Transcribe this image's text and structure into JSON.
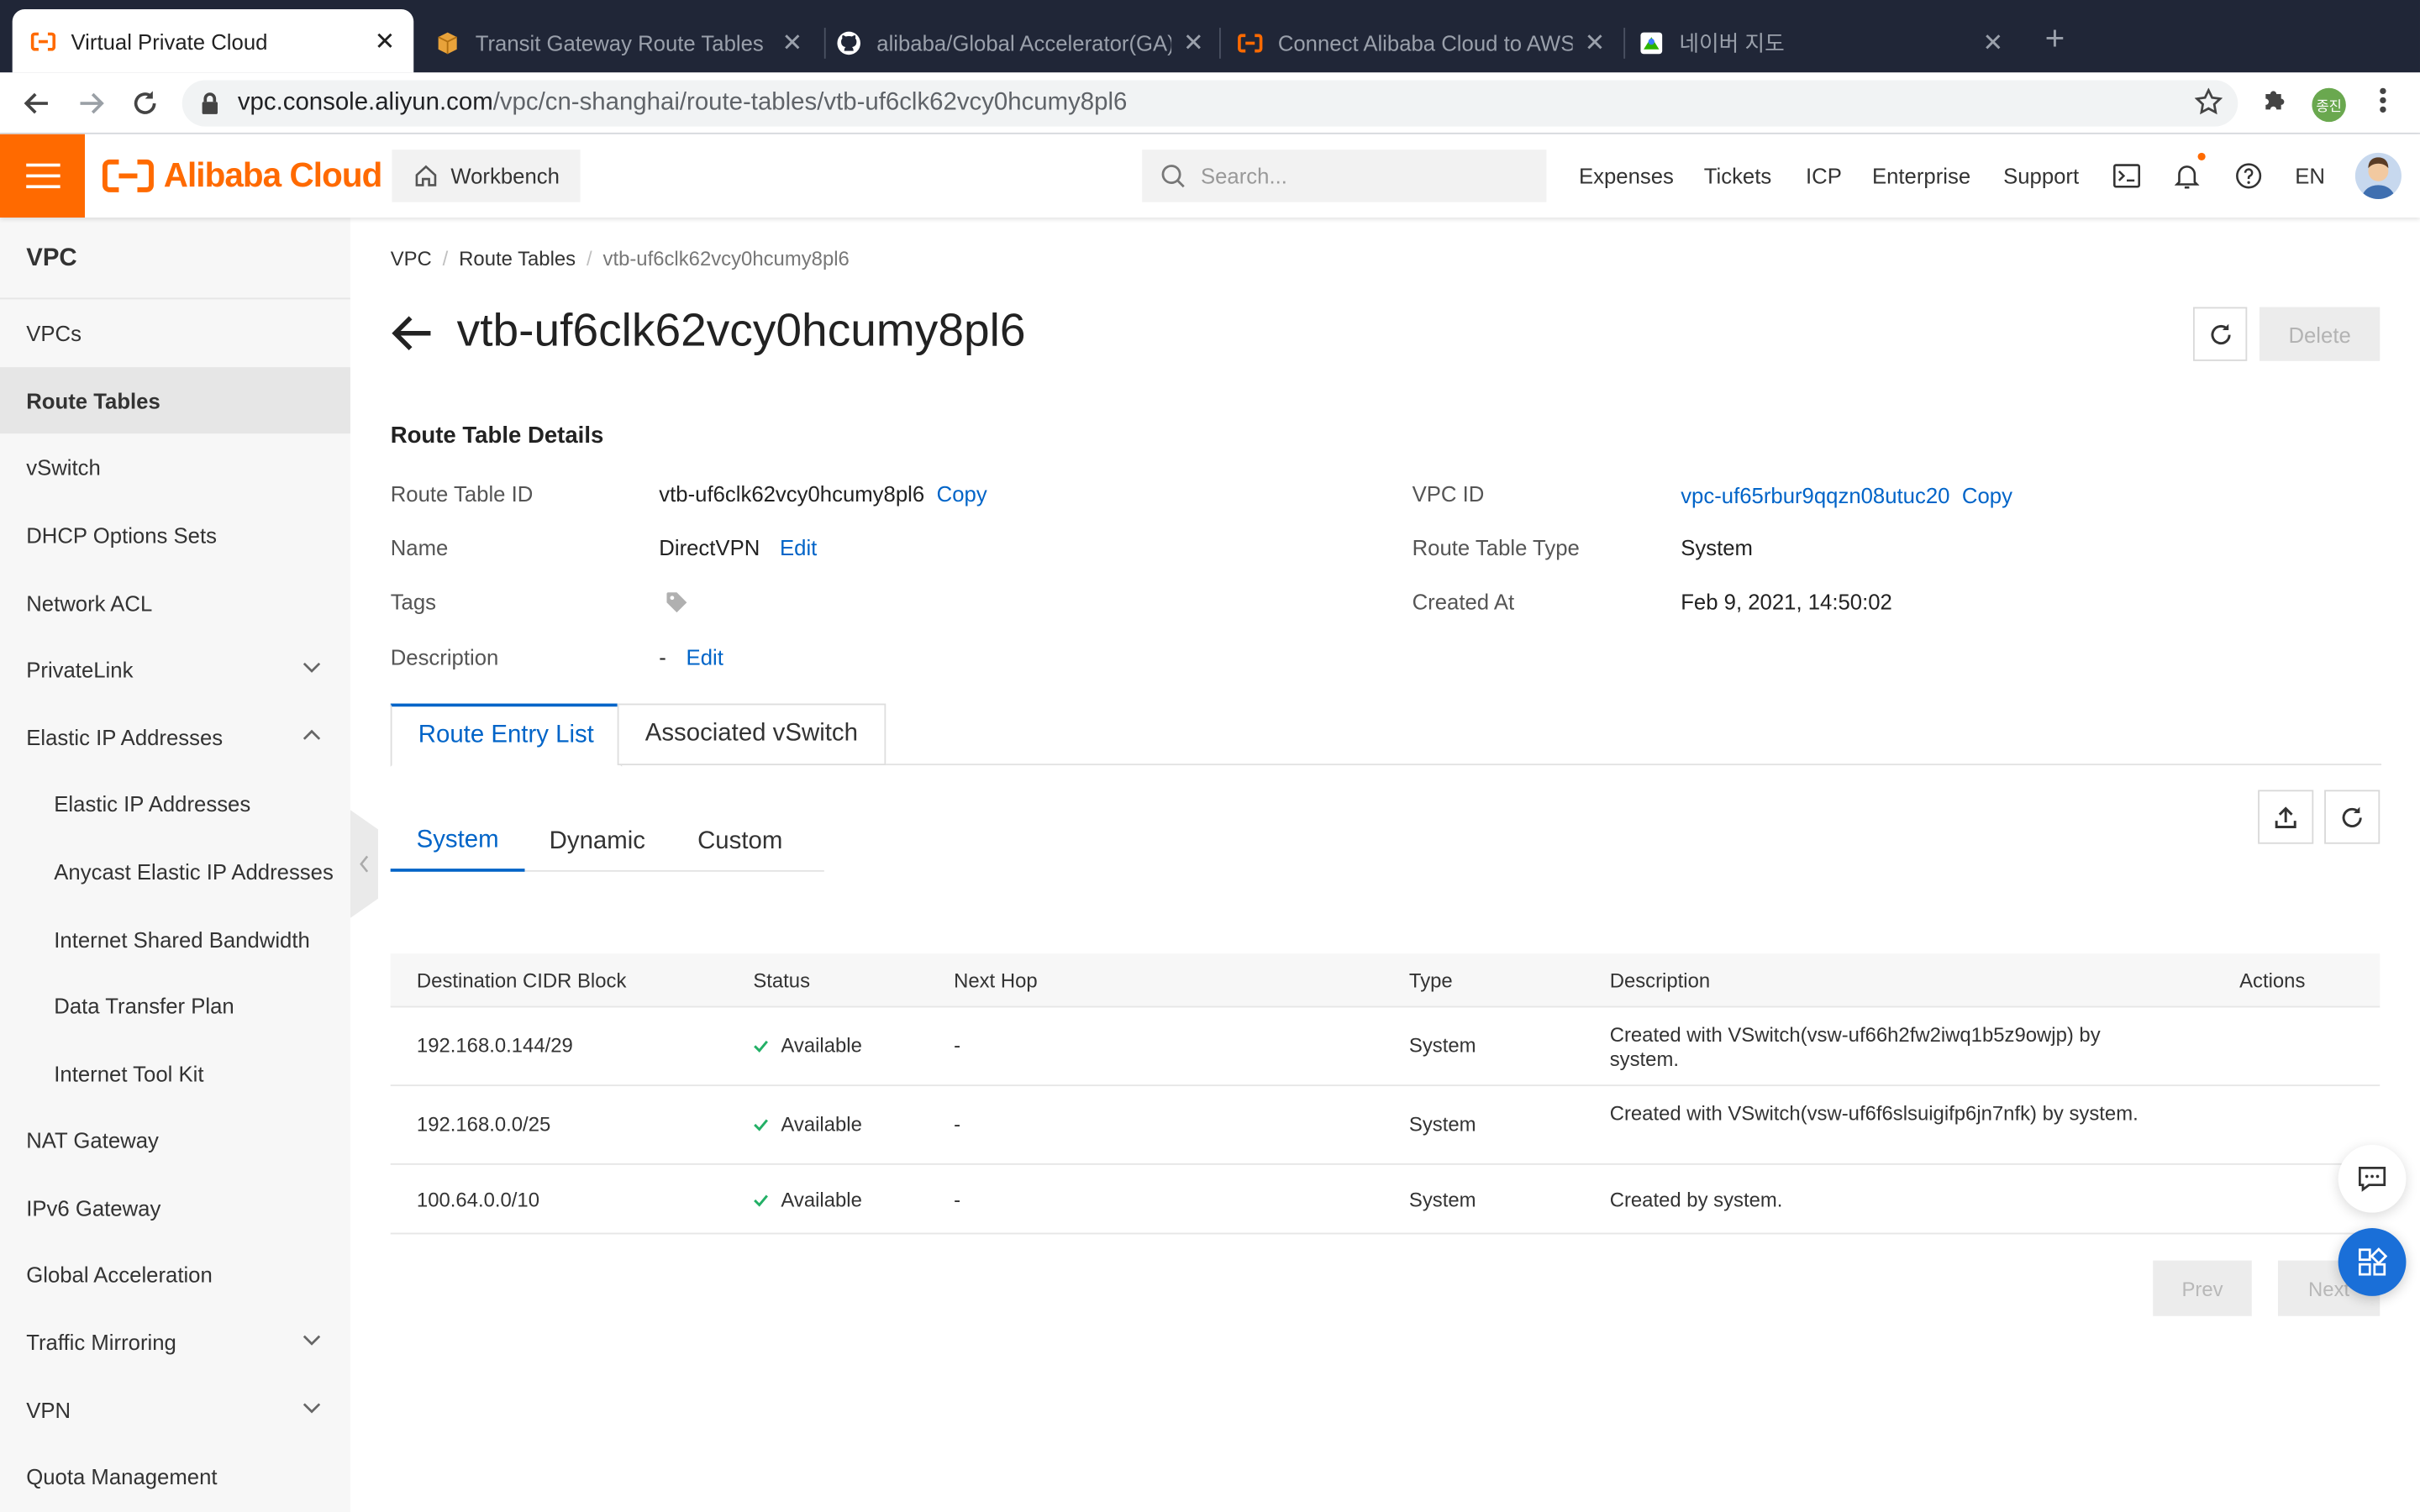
{
  "browser": {
    "tabs": [
      {
        "label": "Virtual Private Cloud"
      },
      {
        "label": "Transit Gateway Route Tables |"
      },
      {
        "label": "alibaba/Global Accelerator(GA)"
      },
      {
        "label": "Connect Alibaba Cloud to AWS"
      },
      {
        "label": "네이버 지도"
      }
    ],
    "url_host": "vpc.console.aliyun.com",
    "url_path": "/vpc/cn-shanghai/route-tables/vtb-uf6clk62vcy0hcumy8pl6",
    "profile_label": "종진"
  },
  "header": {
    "brand": "Alibaba Cloud",
    "workbench": "Workbench",
    "search_placeholder": "Search...",
    "links": [
      "Expenses",
      "Tickets",
      "ICP",
      "Enterprise",
      "Support"
    ],
    "lang": "EN"
  },
  "sidebar": {
    "title": "VPC",
    "items": [
      {
        "label": "VPCs"
      },
      {
        "label": "Route Tables"
      },
      {
        "label": "vSwitch"
      },
      {
        "label": "DHCP Options Sets"
      },
      {
        "label": "Network ACL"
      },
      {
        "label": "PrivateLink"
      },
      {
        "label": "Elastic IP Addresses"
      },
      {
        "label": "Elastic IP Addresses"
      },
      {
        "label": "Anycast Elastic IP Addresses"
      },
      {
        "label": "Internet Shared Bandwidth"
      },
      {
        "label": "Data Transfer Plan"
      },
      {
        "label": "Internet Tool Kit"
      },
      {
        "label": "NAT Gateway"
      },
      {
        "label": "IPv6 Gateway"
      },
      {
        "label": "Global Acceleration"
      },
      {
        "label": "Traffic Mirroring"
      },
      {
        "label": "VPN"
      },
      {
        "label": "Quota Management"
      }
    ]
  },
  "breadcrumb": [
    "VPC",
    "Route Tables",
    "vtb-uf6clk62vcy0hcumy8pl6"
  ],
  "page": {
    "title": "vtb-uf6clk62vcy0hcumy8pl6",
    "delete_label": "Delete"
  },
  "details": {
    "section_title": "Route Table Details",
    "route_table_id_label": "Route Table ID",
    "route_table_id": "vtb-uf6clk62vcy0hcumy8pl6",
    "copy_label": "Copy",
    "name_label": "Name",
    "name": "DirectVPN",
    "edit_label": "Edit",
    "tags_label": "Tags",
    "description_label": "Description",
    "description": "-",
    "vpc_id_label": "VPC ID",
    "vpc_id": "vpc-uf65rbur9qqzn08utuc20",
    "type_label": "Route Table Type",
    "type": "System",
    "created_label": "Created At",
    "created": "Feb 9, 2021, 14:50:02"
  },
  "tabs_main": [
    "Route Entry List",
    "Associated vSwitch"
  ],
  "tabs_sub": [
    "System",
    "Dynamic",
    "Custom"
  ],
  "table": {
    "columns": [
      "Destination CIDR Block",
      "Status",
      "Next Hop",
      "Type",
      "Description",
      "Actions"
    ],
    "rows": [
      {
        "cidr": "192.168.0.144/29",
        "status": "Available",
        "next_hop": "-",
        "type": "System",
        "description": "Created with VSwitch(vsw-uf66h2fw2iwq1b5z9owjp) by system."
      },
      {
        "cidr": "192.168.0.0/25",
        "status": "Available",
        "next_hop": "-",
        "type": "System",
        "description": "Created with VSwitch(vsw-uf6f6slsuigifp6jn7nfk) by system."
      },
      {
        "cidr": "100.64.0.0/10",
        "status": "Available",
        "next_hop": "-",
        "type": "System",
        "description": "Created by system."
      }
    ]
  },
  "pager": {
    "prev": "Prev",
    "next": "Next"
  },
  "colors": {
    "accent_orange": "#ff6a00",
    "link_blue": "#0064c8",
    "success_green": "#23b066"
  }
}
